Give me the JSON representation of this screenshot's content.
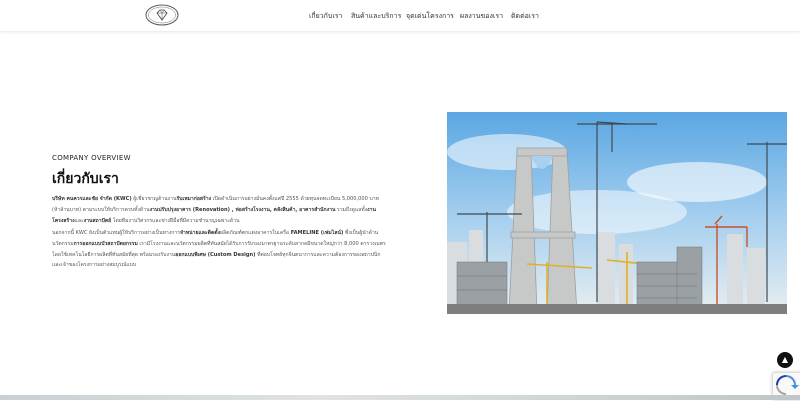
{
  "nav": {
    "items": [
      {
        "label": "เกี่ยวกับเรา"
      },
      {
        "label": "สินค้าและบริการ"
      },
      {
        "label": "จุดเด่นโครงการ"
      },
      {
        "label": "ผลงานของเรา"
      },
      {
        "label": "ติดต่อเรา"
      }
    ]
  },
  "about": {
    "overline": "COMPANY OVERVIEW",
    "title": "เกี่ยวกับเรา",
    "p1": {
      "company": "บริษัท คนควรและชัย จำกัด (KWC)",
      "text_a": " ผู้เชี่ยวชาญด้านงาน",
      "bold_a": "รับเหมาก่อสร้าง",
      "text_b": " เปิดดำเนินการอย่างมั่นคงตั้งแต่ปี 2555 ด้วยทุนจดทะเบียน 5,000,000 บาท (ห้าล้านบาท) ตามระบบให้บริการครบทั้งด้าน",
      "bold_b": "งานปรับปรุงอาคาร (Renovation) , ห่อสร้างโรงงาน, คลังสินค้า, อาคารสำนักงาน",
      "text_c": " รวมถึงดูแลทั้ง",
      "bold_c": "งานโครงสร้าง",
      "text_d": "และ",
      "bold_d": "งานสถาปัตย์",
      "text_e": " โดยทีมงานวิศวกรและช่างฝีมือที่มีความชำนาญเฉพาะด้าน"
    },
    "p2": {
      "text_a": "นอกจากนี้ KWC ยังเป็นตัวแทนผู้ให้บริการอย่างเป็นทางการ",
      "bold_a": "จำหน่ายและติดตั้ง",
      "text_b": "ผลิตภัณฑ์ตกแต่งอาคารในเครือ ",
      "bold_b": "FAMELINE (เฟมไลน์)",
      "text_c": " ซึ่งเป็นผู้นำด้านนวัตกรรม",
      "bold_c": "การออกแบบบัวสถาปัตยกรรม",
      "text_d": " เรามีโรงงานและนวัตกรรมผลิตที่ทันสมัยได้รับการรับรองมาตรฐานระดับสากลมีขนาดใหญ่กว่า 8,000 ตารางเมตร โดยใช้เทคโนโลยีการผลิตที่ทันสมัยที่สุด พร้อมรองรับงาน",
      "bold_d": "ออกแบบพิเศษ (Custom Design)",
      "text_e": " ที่ตอบโจทย์ทุกจินตนาการและความต้องการของสถาปนิกและเจ้าของโครงการอย่างสมบูรณ์แบบ"
    }
  },
  "hero": {
    "icon": "construction-site-image"
  },
  "back_to_top": {
    "symbol": "▲"
  },
  "colors": {
    "accent": "#111111",
    "text": "#555555",
    "sky": "#6fb2e6"
  }
}
